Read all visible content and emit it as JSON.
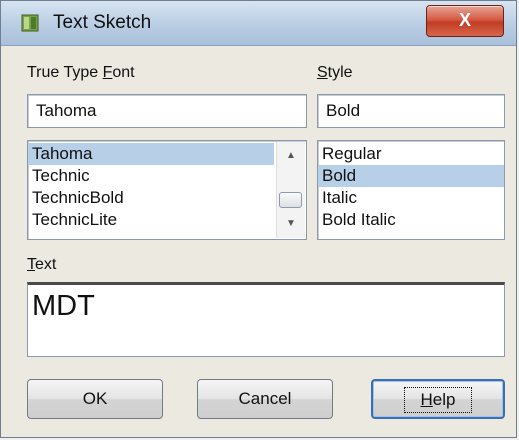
{
  "window": {
    "title": "Text Sketch",
    "close_label": "X"
  },
  "font": {
    "label_prefix": "True Type ",
    "label_mnemonic": "F",
    "label_suffix": "ont",
    "value": "Tahoma",
    "list": [
      "Tahoma",
      "Technic",
      "TechnicBold",
      "TechnicLite"
    ],
    "selected_index": 0
  },
  "style": {
    "label_mnemonic": "S",
    "label_suffix": "tyle",
    "value": "Bold",
    "list": [
      "Regular",
      "Bold",
      "Italic",
      "Bold Italic"
    ],
    "selected_index": 1
  },
  "text": {
    "label_mnemonic": "T",
    "label_suffix": "ext",
    "value": "MDT"
  },
  "buttons": {
    "ok_label": "OK",
    "cancel_label": "Cancel",
    "help_mnemonic": "H",
    "help_suffix": "elp"
  },
  "icons": {
    "app": "text-sketch-icon",
    "close": "close-icon",
    "scroll_up": "scroll-up-arrow-icon",
    "scroll_down": "scroll-down-arrow-icon"
  }
}
